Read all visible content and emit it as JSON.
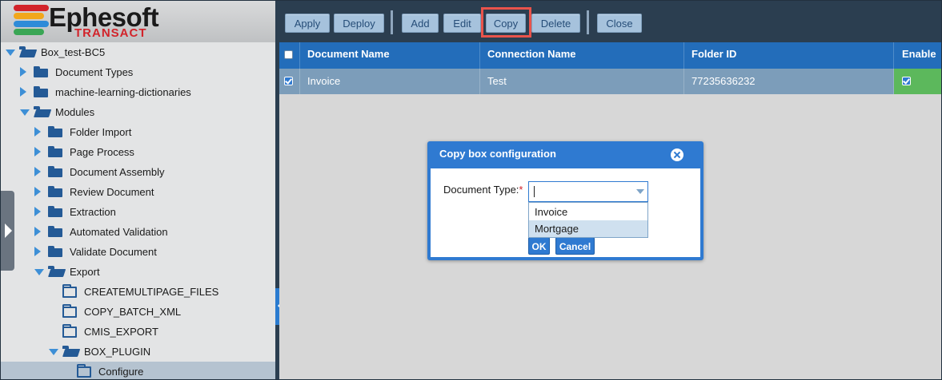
{
  "logo": {
    "name": "Ephesoft",
    "sub": "TRANSACT",
    "strip_colors": [
      "#d2232a",
      "#f2a71b",
      "#2e8bd8",
      "#3aa655"
    ]
  },
  "tree": [
    {
      "label": "Box_test-BC5",
      "level": 0,
      "toggle": "down",
      "folder": "open",
      "selected": false
    },
    {
      "label": "Document Types",
      "level": 1,
      "toggle": "right",
      "folder": "solid",
      "selected": false
    },
    {
      "label": "machine-learning-dictionaries",
      "level": 1,
      "toggle": "right",
      "folder": "solid",
      "selected": false
    },
    {
      "label": "Modules",
      "level": 1,
      "toggle": "down",
      "folder": "open",
      "selected": false
    },
    {
      "label": "Folder Import",
      "level": 2,
      "toggle": "right",
      "folder": "solid",
      "selected": false
    },
    {
      "label": "Page Process",
      "level": 2,
      "toggle": "right",
      "folder": "solid",
      "selected": false
    },
    {
      "label": "Document Assembly",
      "level": 2,
      "toggle": "right",
      "folder": "solid",
      "selected": false
    },
    {
      "label": "Review Document",
      "level": 2,
      "toggle": "right",
      "folder": "solid",
      "selected": false
    },
    {
      "label": "Extraction",
      "level": 2,
      "toggle": "right",
      "folder": "solid",
      "selected": false
    },
    {
      "label": "Automated Validation",
      "level": 2,
      "toggle": "right",
      "folder": "solid",
      "selected": false
    },
    {
      "label": "Validate Document",
      "level": 2,
      "toggle": "right",
      "folder": "solid",
      "selected": false
    },
    {
      "label": "Export",
      "level": 2,
      "toggle": "down",
      "folder": "open",
      "selected": false
    },
    {
      "label": "CREATEMULTIPAGE_FILES",
      "level": 3,
      "toggle": "none",
      "folder": "outline",
      "selected": false
    },
    {
      "label": "COPY_BATCH_XML",
      "level": 3,
      "toggle": "none",
      "folder": "outline",
      "selected": false
    },
    {
      "label": "CMIS_EXPORT",
      "level": 3,
      "toggle": "none",
      "folder": "outline",
      "selected": false
    },
    {
      "label": "BOX_PLUGIN",
      "level": 3,
      "toggle": "down",
      "folder": "open",
      "selected": false
    },
    {
      "label": "Configure",
      "level": 4,
      "toggle": "none",
      "folder": "outline",
      "selected": true
    }
  ],
  "toolbar": {
    "apply": "Apply",
    "deploy": "Deploy",
    "add": "Add",
    "edit": "Edit",
    "copy": "Copy",
    "delete": "Delete",
    "close": "Close"
  },
  "grid": {
    "headers": {
      "document_name": "Document Name",
      "connection_name": "Connection Name",
      "folder_id": "Folder ID",
      "enable": "Enable"
    },
    "rows": [
      {
        "selected": true,
        "document_name": "Invoice",
        "connection_name": "Test",
        "folder_id": "77235636232",
        "enabled": true
      }
    ]
  },
  "dialog": {
    "title": "Copy box configuration",
    "field_label": "Document Type:",
    "required_mark": "*",
    "value": "",
    "options": [
      "Invoice",
      "Mortgage"
    ],
    "highlighted_option": "Mortgage",
    "ok": "OK",
    "cancel": "Cancel"
  },
  "colors": {
    "accent": "#2f7ad1",
    "header": "#236dba",
    "selected_row": "#7c9dba",
    "enabled_cell": "#5cb85c",
    "highlight_box": "#e9534b"
  }
}
